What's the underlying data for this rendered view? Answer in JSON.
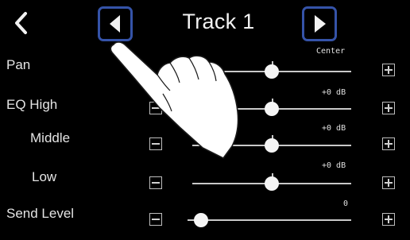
{
  "header": {
    "title": "Track 1",
    "back_icon": "chevron-left-icon",
    "prev_icon": "triangle-left-icon",
    "next_icon": "triangle-right-icon",
    "highlight_color": "#3553a8"
  },
  "rows": [
    {
      "label": "Pan",
      "value": "Center",
      "level": 0.5
    },
    {
      "label": "EQ High",
      "value": "+0 dB",
      "level": 0.5
    },
    {
      "label": "Middle",
      "value": "+0 dB",
      "level": 0.5
    },
    {
      "label": "Low",
      "value": "+0 dB",
      "level": 0.5
    },
    {
      "label": "Send Level",
      "value": "0",
      "level": 0.0
    }
  ],
  "overlay": {
    "icon": "pointing-hand-icon"
  }
}
